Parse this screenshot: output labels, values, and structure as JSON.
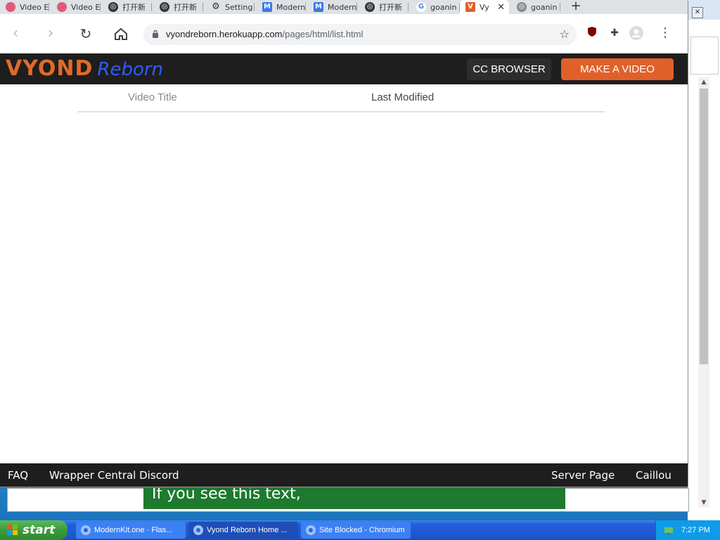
{
  "browser": {
    "tabs": [
      {
        "label": "Video E",
        "icon": "video-editor-icon"
      },
      {
        "label": "Video E",
        "icon": "video-editor-icon"
      },
      {
        "label": "打开新",
        "icon": "globe-icon"
      },
      {
        "label": "打开新",
        "icon": "globe-icon"
      },
      {
        "label": "Setting",
        "icon": "gear-icon"
      },
      {
        "label": "Modern",
        "icon": "modernkit-icon"
      },
      {
        "label": "Modern",
        "icon": "modernkit-icon"
      },
      {
        "label": "打开新",
        "icon": "globe-icon"
      },
      {
        "label": "goanin",
        "icon": "google-icon"
      },
      {
        "label": "Vy",
        "icon": "vyond-icon",
        "active": true
      },
      {
        "label": "goanin",
        "icon": "globe-icon"
      }
    ],
    "url_host": "vyondreborn.herokuapp.com",
    "url_path": "/pages/html/list.html"
  },
  "site": {
    "logo_main": "VYOND",
    "logo_sub": "Reborn",
    "cc_browser": "CC BROWSER",
    "make_video": "MAKE A VIDEO",
    "columns": {
      "title": "Video Title",
      "modified": "Last Modified"
    },
    "footer": {
      "faq": "FAQ",
      "discord": "Wrapper Central Discord",
      "server_page": "Server Page",
      "caillou": "Caillou"
    }
  },
  "background": {
    "banner_text": "If you see this text,"
  },
  "taskbar": {
    "start": "start",
    "tasks": [
      {
        "label": "ModernKit.one · Flas..."
      },
      {
        "label": "Vyond Reborn Home ..."
      },
      {
        "label": "Site Blocked - Chromium"
      }
    ],
    "clock": "7:27 PM"
  },
  "colors": {
    "accent": "#e0602a",
    "header_bg": "#1e1e1e",
    "logo_blue": "#2f5bff"
  }
}
